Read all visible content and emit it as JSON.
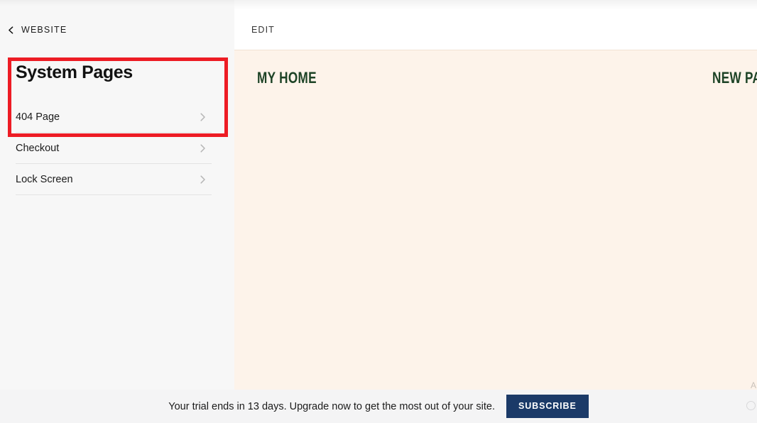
{
  "sidebar": {
    "back_nav": {
      "icon": "chevron-left-icon",
      "label": "WEBSITE"
    },
    "section_title": "System Pages",
    "items": [
      {
        "label": "404 Page",
        "chevron": "chevron-right-icon"
      },
      {
        "label": "Checkout",
        "chevron": "chevron-right-icon"
      },
      {
        "label": "Lock Screen",
        "chevron": "chevron-right-icon"
      }
    ],
    "highlight_color": "#ed1c24"
  },
  "main": {
    "toolbar": {
      "edit_tab_label": "EDIT"
    },
    "site_preview": {
      "background_color": "#fdf3ea",
      "text_color": "#1d4326",
      "logo": "MY HOME",
      "nav_item": "NEW PA"
    },
    "edge_glyph": "A"
  },
  "trial_banner": {
    "message": "Your trial ends in 13 days. Upgrade now to get the most out of your site.",
    "subscribe_label": "SUBSCRIBE",
    "subscribe_color": "#1b3a68",
    "edge_icon": "circle-icon"
  }
}
